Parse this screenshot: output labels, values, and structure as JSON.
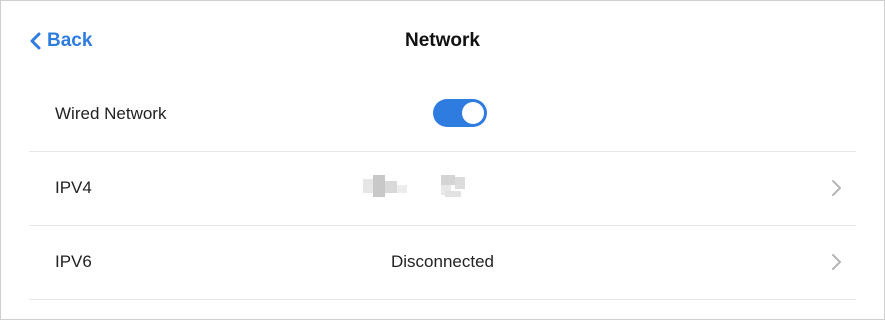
{
  "header": {
    "back_label": "Back",
    "title": "Network"
  },
  "rows": [
    {
      "label": "Wired Network",
      "toggle_on": true
    },
    {
      "label": "IPV4",
      "value_redacted": true
    },
    {
      "label": "IPV6",
      "value": "Disconnected"
    }
  ],
  "colors": {
    "accent": "#2f7ce0",
    "divider": "#e6e6e6",
    "chevron": "#b5b5b5"
  },
  "icons": {
    "back": "chevron-left-icon",
    "row_chevron": "chevron-right-icon"
  }
}
